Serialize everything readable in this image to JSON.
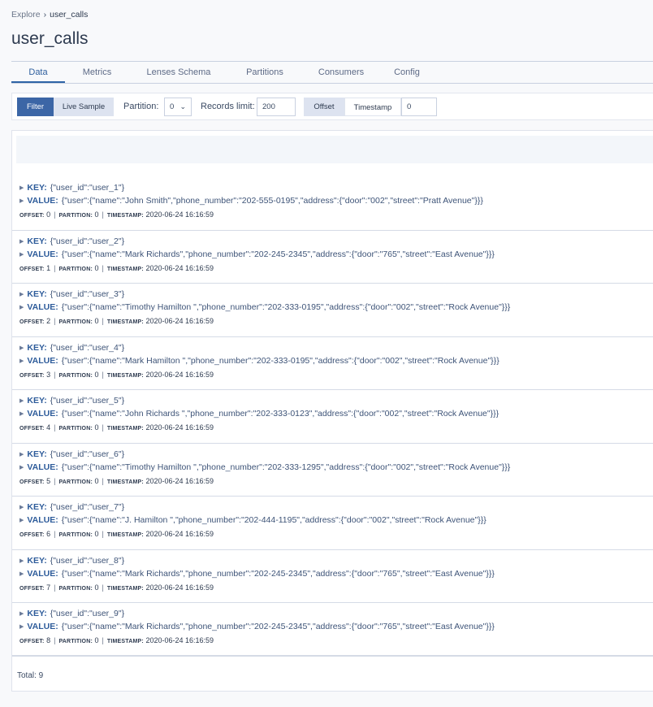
{
  "breadcrumb": {
    "root": "Explore",
    "separator": "›",
    "current": "user_calls"
  },
  "page_title": "user_calls",
  "tabs": [
    {
      "label": "Data",
      "active": true
    },
    {
      "label": "Metrics",
      "active": false
    },
    {
      "label": "Lenses Schema",
      "active": false
    },
    {
      "label": "Partitions",
      "active": false
    },
    {
      "label": "Consumers",
      "active": false
    },
    {
      "label": "Config",
      "active": false
    }
  ],
  "toolbar": {
    "filter_label": "Filter",
    "live_sample_label": "Live Sample",
    "partition_label": "Partition:",
    "partition_value": "0",
    "records_limit_label": "Records limit:",
    "records_limit_value": "200",
    "offset_label": "Offset",
    "timestamp_label": "Timestamp",
    "offset_input_value": "0"
  },
  "labels": {
    "key": "KEY:",
    "value": "VALUE:",
    "offset": "OFFSET:",
    "partition": "PARTITION:",
    "timestamp": "TIMESTAMP:"
  },
  "records": [
    {
      "key": "{\"user_id\":\"user_1\"}",
      "value": "{\"user\":{\"name\":\"John Smith\",\"phone_number\":\"202-555-0195\",\"address\":{\"door\":\"002\",\"street\":\"Pratt Avenue\"}}}",
      "offset": "0",
      "partition": "0",
      "timestamp": "2020-06-24 16:16:59"
    },
    {
      "key": "{\"user_id\":\"user_2\"}",
      "value": "{\"user\":{\"name\":\"Mark Richards\",\"phone_number\":\"202-245-2345\",\"address\":{\"door\":\"765\",\"street\":\"East Avenue\"}}}",
      "offset": "1",
      "partition": "0",
      "timestamp": "2020-06-24 16:16:59"
    },
    {
      "key": "{\"user_id\":\"user_3\"}",
      "value": "{\"user\":{\"name\":\"Timothy Hamilton \",\"phone_number\":\"202-333-0195\",\"address\":{\"door\":\"002\",\"street\":\"Rock Avenue\"}}}",
      "offset": "2",
      "partition": "0",
      "timestamp": "2020-06-24 16:16:59"
    },
    {
      "key": "{\"user_id\":\"user_4\"}",
      "value": "{\"user\":{\"name\":\"Mark Hamilton \",\"phone_number\":\"202-333-0195\",\"address\":{\"door\":\"002\",\"street\":\"Rock Avenue\"}}}",
      "offset": "3",
      "partition": "0",
      "timestamp": "2020-06-24 16:16:59"
    },
    {
      "key": "{\"user_id\":\"user_5\"}",
      "value": "{\"user\":{\"name\":\"John Richards \",\"phone_number\":\"202-333-0123\",\"address\":{\"door\":\"002\",\"street\":\"Rock Avenue\"}}}",
      "offset": "4",
      "partition": "0",
      "timestamp": "2020-06-24 16:16:59"
    },
    {
      "key": "{\"user_id\":\"user_6\"}",
      "value": "{\"user\":{\"name\":\"Timothy Hamilton \",\"phone_number\":\"202-333-1295\",\"address\":{\"door\":\"002\",\"street\":\"Rock Avenue\"}}}",
      "offset": "5",
      "partition": "0",
      "timestamp": "2020-06-24 16:16:59"
    },
    {
      "key": "{\"user_id\":\"user_7\"}",
      "value": "{\"user\":{\"name\":\"J. Hamilton \",\"phone_number\":\"202-444-1195\",\"address\":{\"door\":\"002\",\"street\":\"Rock Avenue\"}}}",
      "offset": "6",
      "partition": "0",
      "timestamp": "2020-06-24 16:16:59"
    },
    {
      "key": "{\"user_id\":\"user_8\"}",
      "value": "{\"user\":{\"name\":\"Mark Richards\",\"phone_number\":\"202-245-2345\",\"address\":{\"door\":\"765\",\"street\":\"East Avenue\"}}}",
      "offset": "7",
      "partition": "0",
      "timestamp": "2020-06-24 16:16:59"
    },
    {
      "key": "{\"user_id\":\"user_9\"}",
      "value": "{\"user\":{\"name\":\"Mark Richards\",\"phone_number\":\"202-245-2345\",\"address\":{\"door\":\"765\",\"street\":\"East Avenue\"}}}",
      "offset": "8",
      "partition": "0",
      "timestamp": "2020-06-24 16:16:59"
    }
  ],
  "total_label": "Total: 9"
}
